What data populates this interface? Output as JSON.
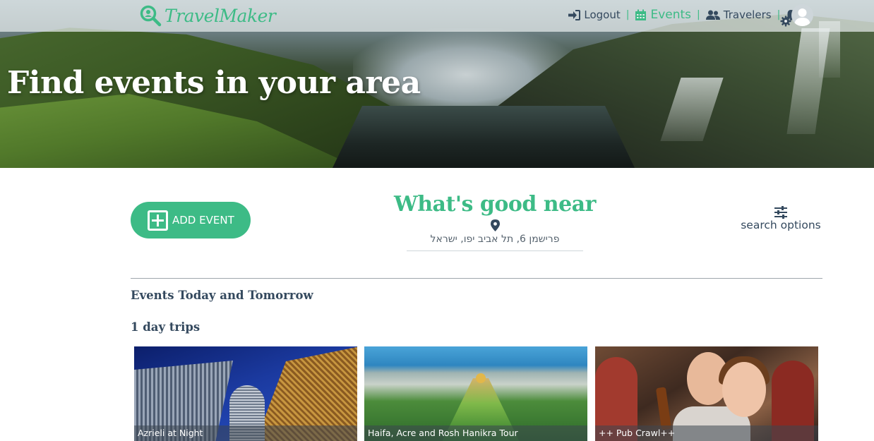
{
  "hero": {
    "title": "Find events in your area"
  },
  "navbar": {
    "logo_text": "TravelMaker",
    "links": [
      {
        "label": "Logout",
        "icon": "sign-in-icon"
      },
      {
        "label": "Events",
        "icon": "calendar-icon",
        "active": true
      },
      {
        "label": "Travelers",
        "icon": "users-icon"
      }
    ],
    "separator": "|",
    "accent_color": "#3dbb86"
  },
  "main": {
    "add_event_label": "ADD EVENT",
    "near_title": "What's good near",
    "address": "פרישמן 6, תל אביב יפו, ישראל",
    "search_options_label": "search options",
    "section_today": "Events Today and Tomorrow",
    "section_trips": "1 day trips",
    "cards": [
      {
        "caption": "Azrieli at Night"
      },
      {
        "caption": "Haifa, Acre and Rosh Hanikra Tour"
      },
      {
        "caption": "++ Pub Crawl++"
      }
    ]
  }
}
